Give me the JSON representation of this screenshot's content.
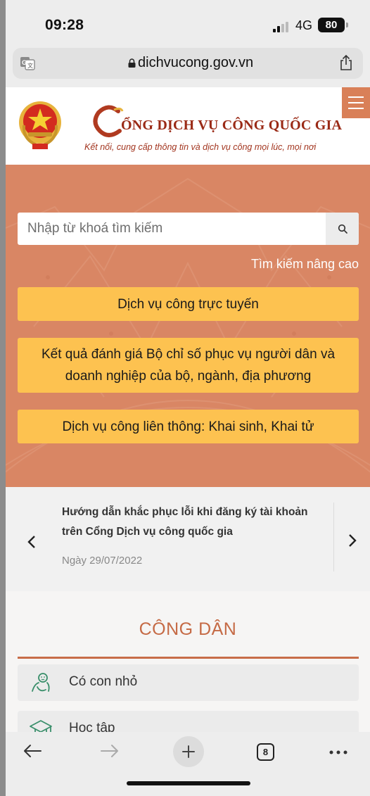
{
  "status_bar": {
    "time": "09:28",
    "network": "4G",
    "battery": "80"
  },
  "browser": {
    "url": "dichvucong.gov.vn",
    "icons": [
      "translate-icon",
      "lock-icon",
      "share-icon"
    ]
  },
  "header": {
    "brand_initial": "C",
    "brand_title": "ỔNG DỊCH VỤ CÔNG QUỐC GIA",
    "tagline": "Kết nối, cung cấp thông tin và dịch vụ công mọi lúc, mọi nơi",
    "brand_color": "#9a2a16",
    "menu_color": "#d98058"
  },
  "hero": {
    "search_placeholder": "Nhập từ khoá tìm kiếm",
    "advanced_search": "Tìm kiếm nâng cao",
    "buttons": [
      "Dịch vụ công trực tuyến",
      "Kết quả đánh giá Bộ chỉ số phục vụ người dân và doanh nghiệp của bộ, ngành, địa phương",
      "Dịch vụ công liên thông: Khai sinh, Khai tử"
    ],
    "bg_color": "#d98664",
    "button_color": "#fdc250"
  },
  "news": {
    "title": "Hướng dẫn khắc phục lỗi khi đăng ký tài khoản trên Cổng Dịch vụ công quốc gia",
    "date": "Ngày 29/07/2022"
  },
  "citizen": {
    "heading": "CÔNG DÂN",
    "items": [
      {
        "label": "Có con nhỏ",
        "icon": "baby-icon"
      },
      {
        "label": "Học tập",
        "icon": "graduation-cap-icon"
      }
    ],
    "accent_color": "#c86d49"
  },
  "toolbar": {
    "tab_count": "8"
  }
}
